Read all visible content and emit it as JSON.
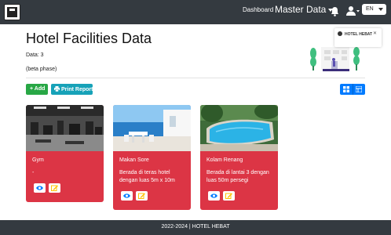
{
  "navbar": {
    "dashboard_label": "Dashboard",
    "master_data_label": "Master Data",
    "language": "EN"
  },
  "page": {
    "title": "Hotel Facilities Data",
    "data_count": "Data: 3",
    "beta_note": "(beta phase)"
  },
  "popup": {
    "label": "HOTEL HEBAT",
    "close": "✕"
  },
  "toolbar": {
    "add_label": "+ Add",
    "print_label": "Print Report"
  },
  "cards": [
    {
      "title": "Gym",
      "description": "-",
      "image": "gym-photo"
    },
    {
      "title": "Makan Sore",
      "description": "Berada di teras hotel dengan luas 5m x 10m",
      "image": "terrace-photo"
    },
    {
      "title": "Kolam Renang",
      "description": "Berada di lantai 3 dengan luas 50m persegi",
      "image": "pool-photo"
    }
  ],
  "footer": {
    "text": "2022-2024 | HOTEL HEBAT"
  },
  "colors": {
    "navbar": "#343a40",
    "card": "#dc3545",
    "add": "#28a745",
    "print": "#17a2b8",
    "primary": "#007bff",
    "edit": "#ffc107"
  }
}
